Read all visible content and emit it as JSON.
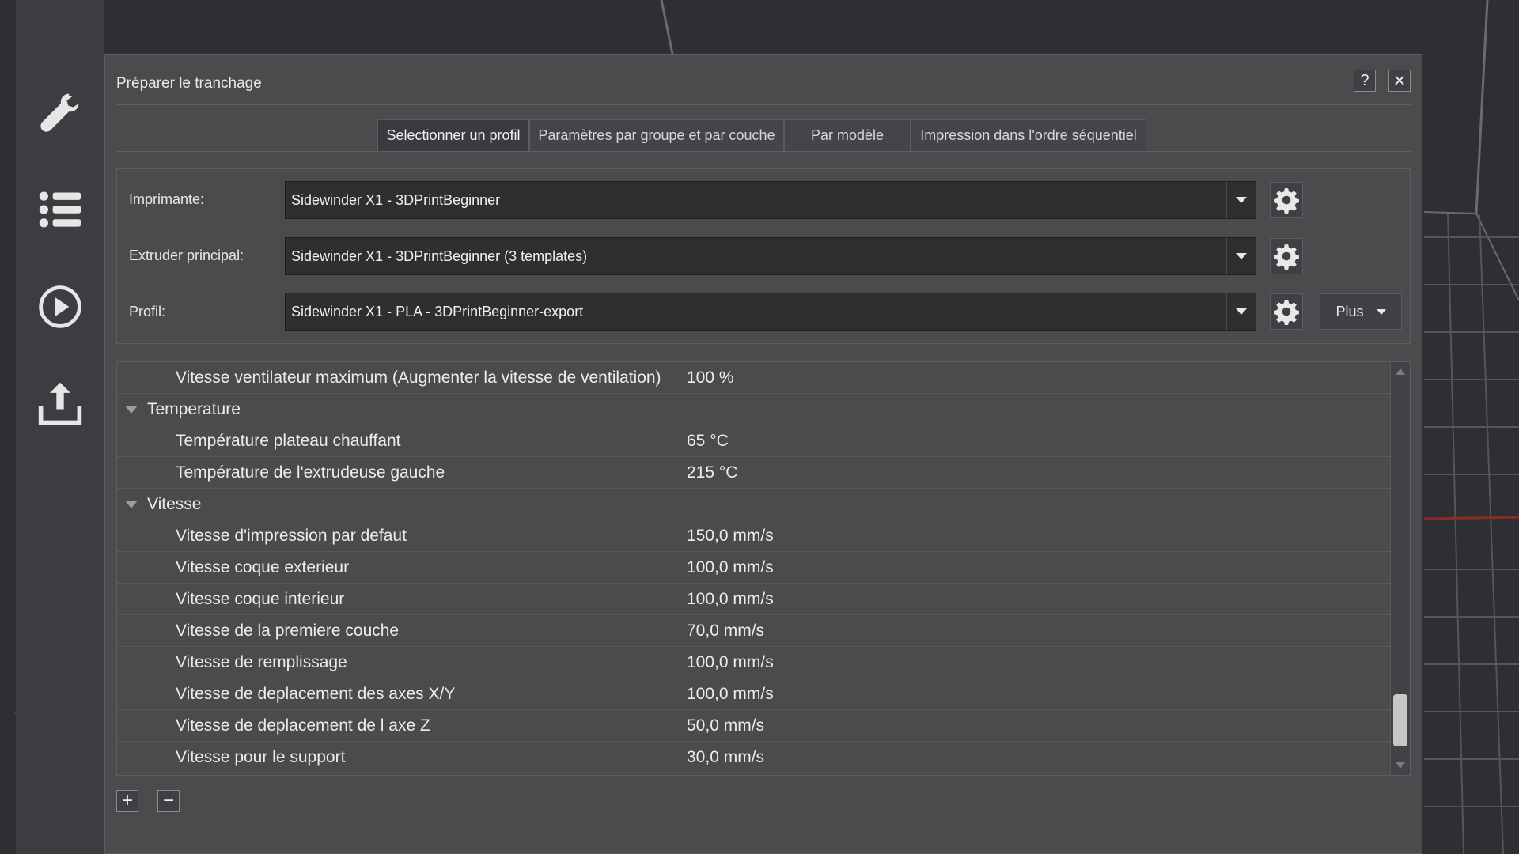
{
  "toolbar": {
    "items": [
      {
        "icon": "wrench-icon",
        "label": ""
      },
      {
        "icon": "list-icon",
        "label": ""
      },
      {
        "icon": "play-icon",
        "label": ""
      },
      {
        "icon": "upload-icon",
        "label": ""
      }
    ]
  },
  "dialog": {
    "title": "Préparer le tranchage",
    "help_label": "?",
    "close_label": "✕",
    "tabs": [
      {
        "label": "Selectionner un profil",
        "active": true
      },
      {
        "label": "Paramètres par groupe et par couche",
        "active": false
      },
      {
        "label": "Par modèle",
        "active": false
      },
      {
        "label": "Impression dans l'ordre séquentiel",
        "active": false
      }
    ],
    "fields": {
      "printer": {
        "label": "Imprimante:",
        "value": "Sidewinder X1 - 3DPrintBeginner"
      },
      "extruder": {
        "label": "Extruder principal:",
        "value": "Sidewinder X1 - 3DPrintBeginner (3 templates)"
      },
      "profile": {
        "label": "Profil:",
        "value": "Sidewinder X1  - PLA - 3DPrintBeginner-export"
      }
    },
    "more_button": "Plus",
    "settings": {
      "rows": [
        {
          "type": "item",
          "name": "Vitesse ventilateur maximum (Augmenter la vitesse de ventilation)",
          "value": "100 %"
        },
        {
          "type": "group",
          "name": "Temperature",
          "value": ""
        },
        {
          "type": "item",
          "name": "Température plateau chauffant",
          "value": "65 °C"
        },
        {
          "type": "item",
          "name": "Température de l'extrudeuse gauche",
          "value": "215 °C"
        },
        {
          "type": "group",
          "name": "Vitesse",
          "value": ""
        },
        {
          "type": "item",
          "name": "Vitesse d'impression par defaut",
          "value": "150,0 mm/s"
        },
        {
          "type": "item",
          "name": "Vitesse coque exterieur",
          "value": "100,0 mm/s"
        },
        {
          "type": "item",
          "name": "Vitesse coque interieur",
          "value": "100,0 mm/s"
        },
        {
          "type": "item",
          "name": "Vitesse de la premiere couche",
          "value": "70,0 mm/s"
        },
        {
          "type": "item",
          "name": "Vitesse de remplissage",
          "value": "100,0 mm/s"
        },
        {
          "type": "item",
          "name": "Vitesse de deplacement des axes X/Y",
          "value": "100,0 mm/s"
        },
        {
          "type": "item",
          "name": "Vitesse de deplacement de l axe Z",
          "value": "50,0 mm/s"
        },
        {
          "type": "item",
          "name": "Vitesse pour le support",
          "value": "30,0 mm/s"
        }
      ]
    },
    "add_label": "+",
    "remove_label": "−"
  },
  "colors": {
    "background": "#2d2f32",
    "toolbar": "#3b3d40",
    "dialog": "#4a4b4d",
    "input": "#2e2f31",
    "accent_red": "#8a2a2a"
  }
}
